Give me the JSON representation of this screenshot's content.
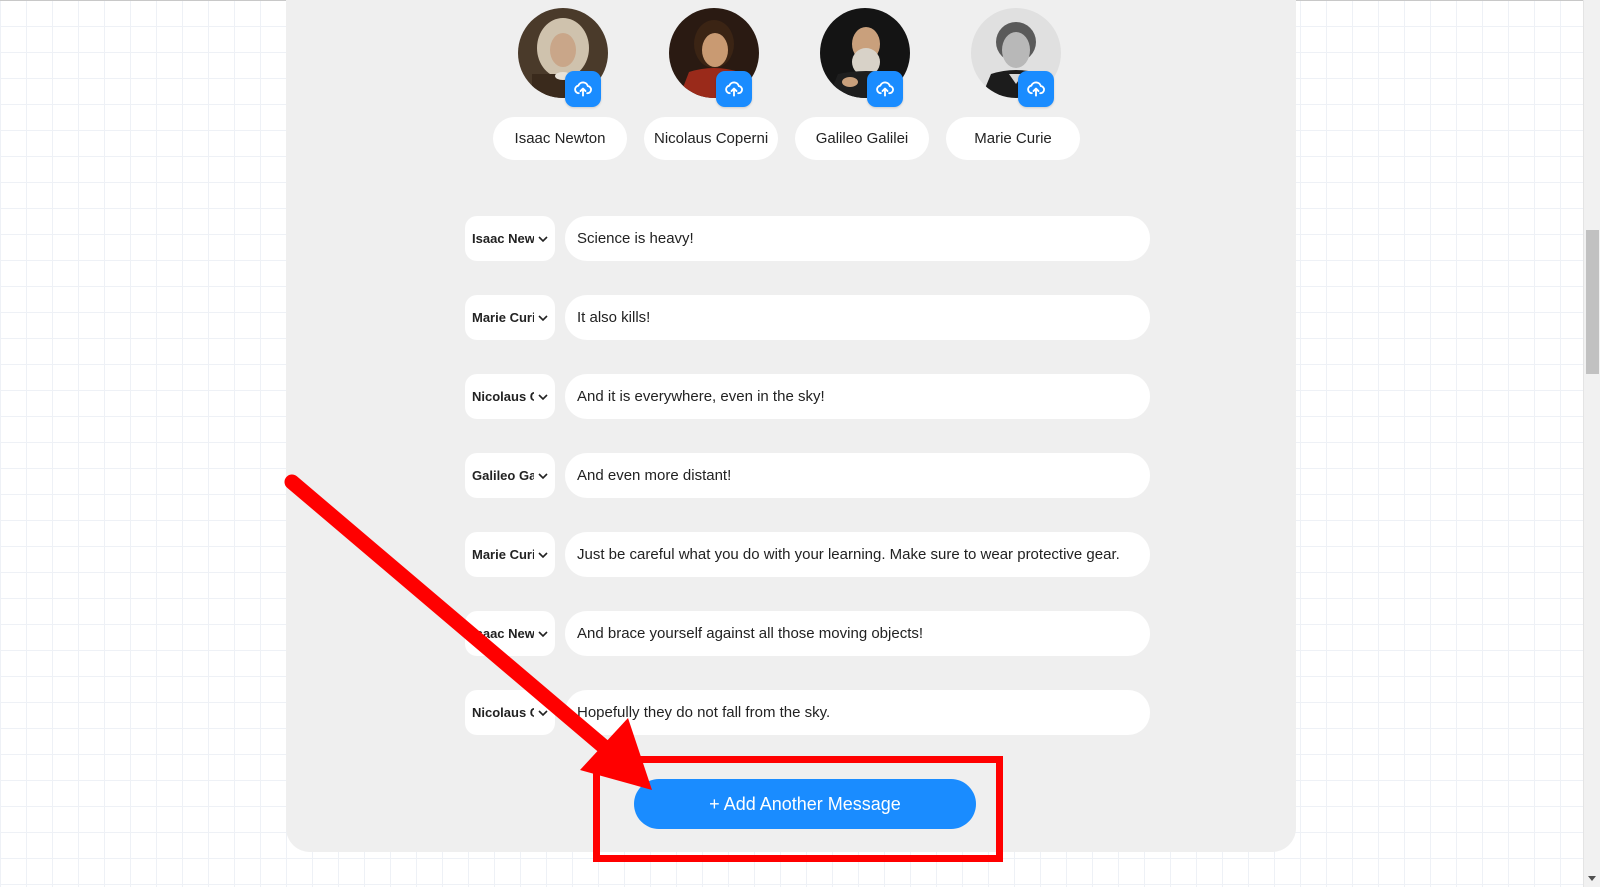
{
  "characters": [
    {
      "name": "Isaac Newton",
      "avatar_icon": "portrait-isaac-newton",
      "upload_icon": "cloud-upload-icon"
    },
    {
      "name": "Nicolaus Copernicus",
      "avatar_icon": "portrait-nicolaus-copernicus",
      "upload_icon": "cloud-upload-icon"
    },
    {
      "name": "Galileo Galilei",
      "avatar_icon": "portrait-galileo-galilei",
      "upload_icon": "cloud-upload-icon"
    },
    {
      "name": "Marie Curie",
      "avatar_icon": "portrait-marie-curie",
      "upload_icon": "cloud-upload-icon"
    }
  ],
  "messages": [
    {
      "speaker": "Isaac Newton",
      "text": "Science is heavy!"
    },
    {
      "speaker": "Marie Curie",
      "text": "It also kills!"
    },
    {
      "speaker": "Nicolaus Copernicus",
      "text": "And it is everywhere, even in the sky!"
    },
    {
      "speaker": "Galileo Galilei",
      "text": "And even more distant!"
    },
    {
      "speaker": "Marie Curie",
      "text": "Just be careful what you do with your learning. Make sure to wear protective gear."
    },
    {
      "speaker": "Isaac Newton",
      "text": "And brace yourself against all those moving objects!"
    },
    {
      "speaker": "Nicolaus Copernicus",
      "text": "Hopefully they do not fall from the sky."
    }
  ],
  "add_button": {
    "label": "+ Add Another Message"
  },
  "colors": {
    "accent": "#1a8cff",
    "panel": "#efefef",
    "annotation": "#ff0000"
  },
  "icons": {
    "select_chevron": "chevron-down-icon",
    "annotation_arrow": "red-arrow-annotation"
  }
}
